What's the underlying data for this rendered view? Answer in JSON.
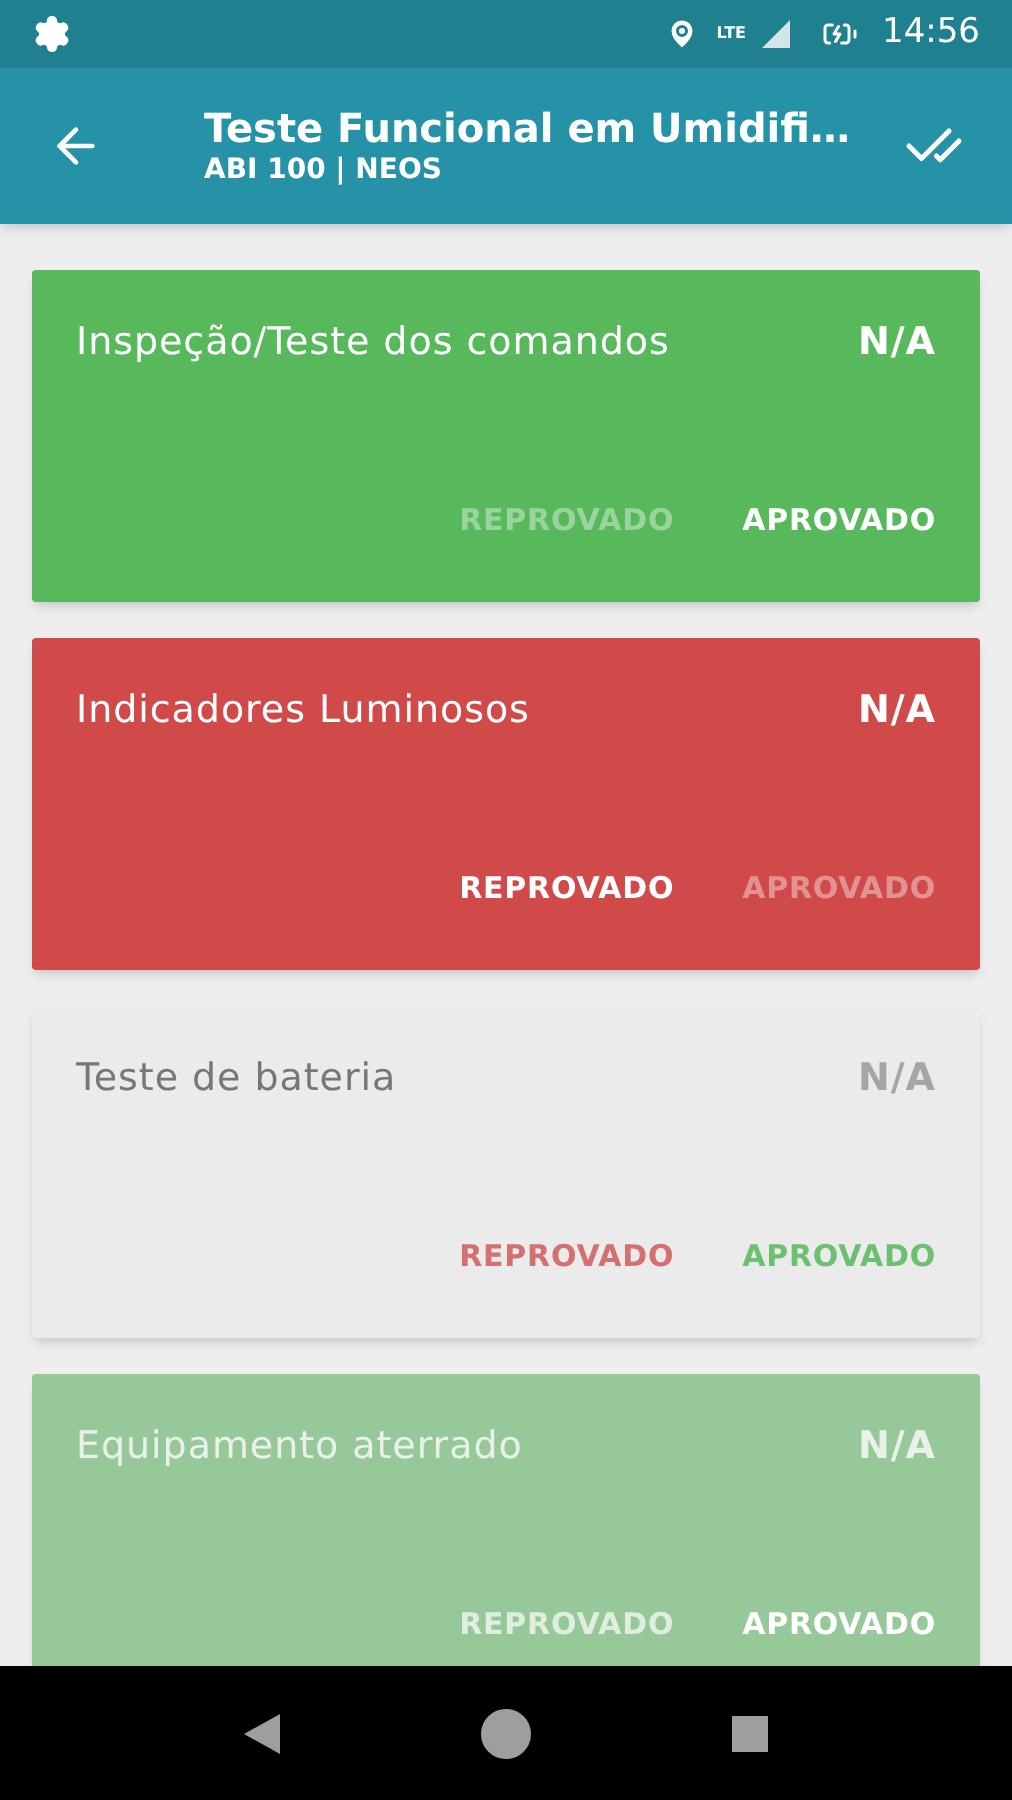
{
  "status_bar": {
    "time": "14:56",
    "network": "LTE"
  },
  "app_bar": {
    "title": "Teste Funcional em Umidifi…",
    "subtitle": "ABI 100 | NEOS"
  },
  "items": [
    {
      "title": "Inspeção/Teste dos comandos",
      "na": "N/A",
      "reject": "REPROVADO",
      "approve": "APROVADO",
      "kind": "approved",
      "faded": false
    },
    {
      "title": "Indicadores Luminosos",
      "na": "N/A",
      "reject": "REPROVADO",
      "approve": "APROVADO",
      "kind": "rejected",
      "faded": false
    },
    {
      "title": "Teste de bateria",
      "na": "N/A",
      "reject": "REPROVADO",
      "approve": "APROVADO",
      "kind": "none",
      "faded": false
    },
    {
      "title": "Equipamento aterrado",
      "na": "N/A",
      "reject": "REPROVADO",
      "approve": "APROVADO",
      "kind": "approved",
      "faded": true
    }
  ]
}
